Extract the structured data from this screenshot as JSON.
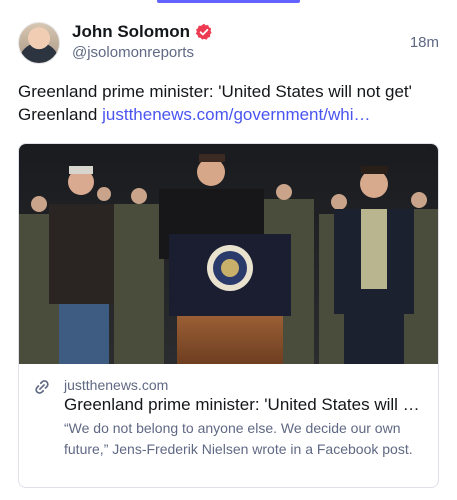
{
  "author": {
    "display_name": "John Solomon",
    "handle": "@jsolomonreports",
    "verified_color": "#ee3a50"
  },
  "post": {
    "time": "18m",
    "text_before_link": "Greenland prime minister: 'United States will not get' Greenland ",
    "link_text": "justthenews.com/government/whi…"
  },
  "link_card": {
    "domain": "justthenews.com",
    "title": "Greenland prime minister: 'United States will n...",
    "description": "“We do not belong to anyone else. We decide our own future,” Jens-Frederik Nielsen wrote in a Facebook post.",
    "icon": "link-icon"
  },
  "colors": {
    "accent": "#6364ff",
    "link": "#4a55f0",
    "muted": "#606984"
  }
}
